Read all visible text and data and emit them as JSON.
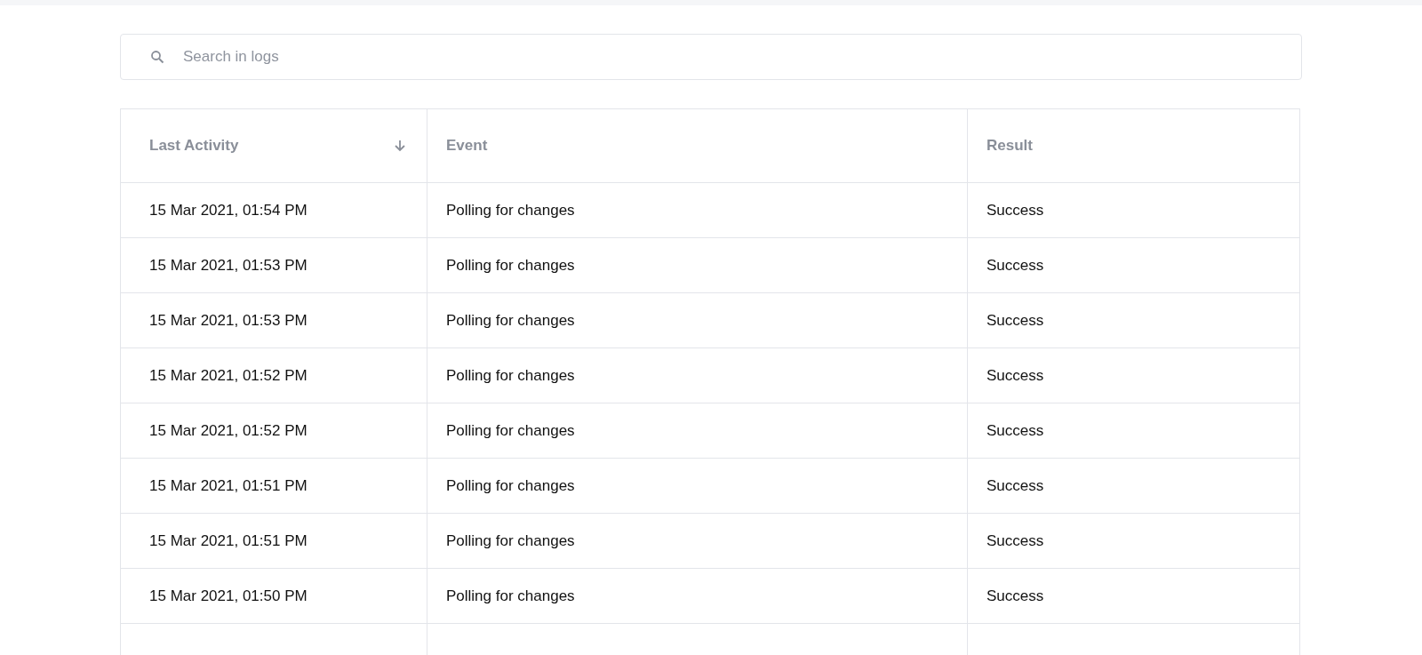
{
  "search": {
    "placeholder": "Search in logs"
  },
  "table": {
    "columns": [
      {
        "label": "Last Activity",
        "sorted": true
      },
      {
        "label": "Event",
        "sorted": false
      },
      {
        "label": "Result",
        "sorted": false
      }
    ],
    "rows": [
      [
        "15 Mar 2021, 01:54 PM",
        "Polling for changes",
        "Success"
      ],
      [
        "15 Mar 2021, 01:53 PM",
        "Polling for changes",
        "Success"
      ],
      [
        "15 Mar 2021, 01:53 PM",
        "Polling for changes",
        "Success"
      ],
      [
        "15 Mar 2021, 01:52 PM",
        "Polling for changes",
        "Success"
      ],
      [
        "15 Mar 2021, 01:52 PM",
        "Polling for changes",
        "Success"
      ],
      [
        "15 Mar 2021, 01:51 PM",
        "Polling for changes",
        "Success"
      ],
      [
        "15 Mar 2021, 01:51 PM",
        "Polling for changes",
        "Success"
      ],
      [
        "15 Mar 2021, 01:50 PM",
        "Polling for changes",
        "Success"
      ]
    ]
  }
}
